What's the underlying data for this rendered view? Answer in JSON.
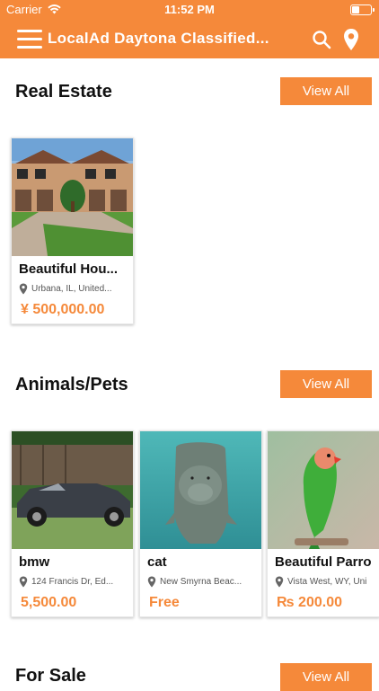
{
  "status_bar": {
    "carrier": "Carrier",
    "time": "11:52 PM",
    "battery_level": 0.4
  },
  "header": {
    "title": "LocalAd Daytona Classified..."
  },
  "sections": [
    {
      "title": "Real Estate",
      "view_all": "View All",
      "items": [
        {
          "name": "Beautiful Hou...",
          "location": "Urbana, IL, United...",
          "price": "¥ 500,000.00"
        }
      ]
    },
    {
      "title": "Animals/Pets",
      "view_all": "View All",
      "items": [
        {
          "name": "bmw",
          "location": "124 Francis Dr, Ed...",
          "price": "5,500.00"
        },
        {
          "name": "cat",
          "location": "New Smyrna Beac...",
          "price": "Free"
        },
        {
          "name": "Beautiful Parro",
          "location": "Vista West, WY, Uni",
          "price": "₨ 200.00"
        }
      ]
    },
    {
      "title": "For Sale",
      "view_all": "View All"
    }
  ],
  "colors": {
    "accent": "#f5893a"
  }
}
